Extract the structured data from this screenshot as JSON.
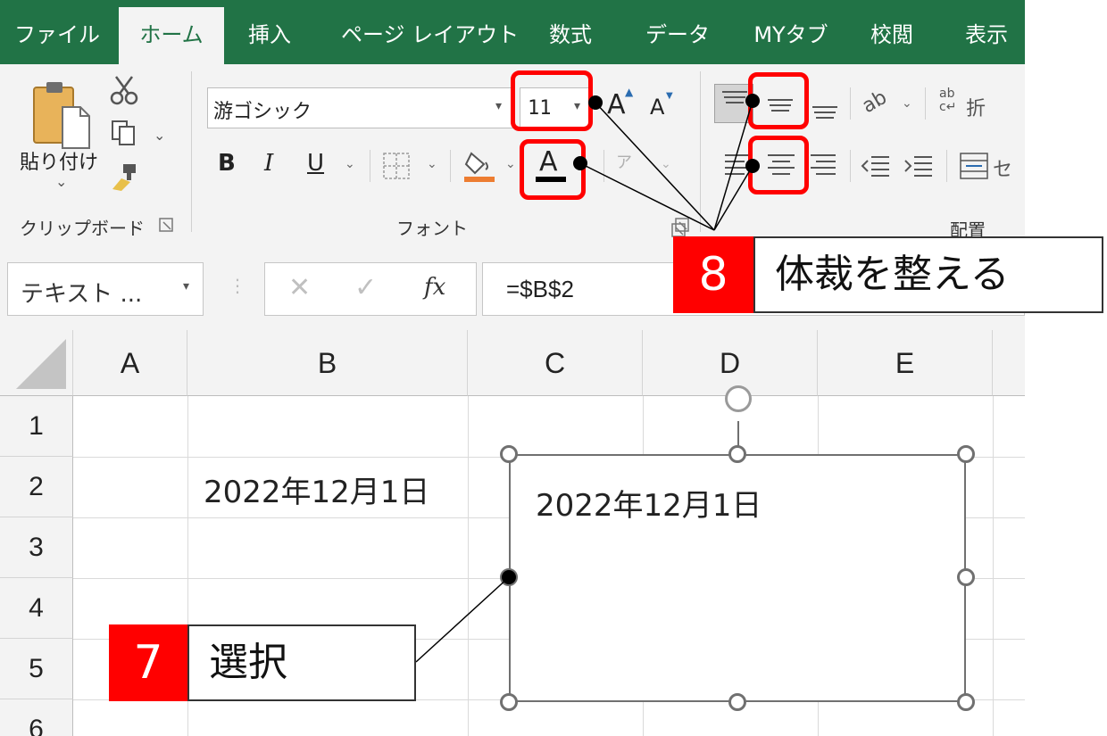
{
  "tabs": [
    "ファイル",
    "ホーム",
    "挿入",
    "ページ レイアウト",
    "数式",
    "データ",
    "MYタブ",
    "校閲",
    "表示"
  ],
  "active_tab": "ホーム",
  "ribbon": {
    "paste_label": "貼り付け",
    "clipboard_group": "クリップボード",
    "font_group": "フォント",
    "align_group": "配置",
    "font_name": "游ゴシック",
    "font_size": "11",
    "bold": "B",
    "italic": "I",
    "underline": "U",
    "font_color_letter": "A",
    "grow_font": "A",
    "shrink_font": "A",
    "wrap_text": "折",
    "merge_text": "セ"
  },
  "formula_bar": {
    "name_box": "テキスト ...",
    "fx": "fx",
    "formula": "=$B$2"
  },
  "columns": [
    "A",
    "B",
    "C",
    "D",
    "E"
  ],
  "rows": [
    "1",
    "2",
    "3",
    "4",
    "5",
    "6"
  ],
  "cell_b2": "2022年12月1日",
  "textbox_text": "2022年12月1日",
  "callouts": {
    "step7_num": "7",
    "step7_text": "選択",
    "step8_num": "8",
    "step8_text": "体裁を整える"
  },
  "colors": {
    "excel_green": "#217346",
    "callout_red": "#ff0000",
    "ribbon_bg": "#f3f3f3"
  }
}
